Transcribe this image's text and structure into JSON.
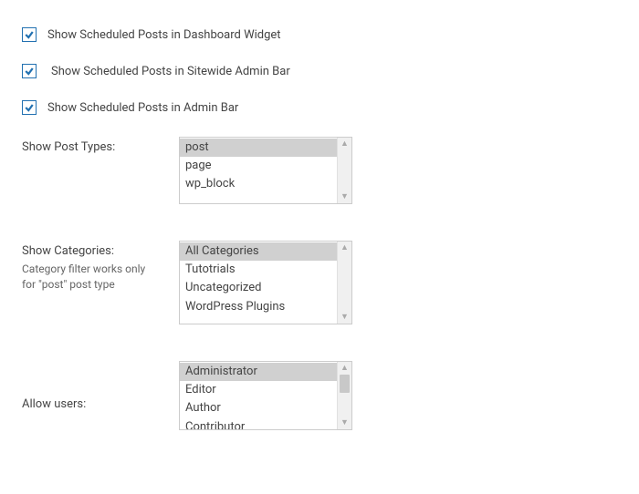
{
  "checkboxes": {
    "dashboard_widget": "Show Scheduled Posts in Dashboard Widget",
    "sitewide_admin_bar": "Show Scheduled Posts in Sitewide Admin Bar",
    "admin_bar": "Show Scheduled Posts in Admin Bar"
  },
  "post_types": {
    "label": "Show Post Types:",
    "options": [
      "post",
      "page",
      "wp_block"
    ],
    "selected": [
      "post"
    ]
  },
  "categories": {
    "label": "Show Categories:",
    "note": "Category filter works only for \"post\" post type",
    "options": [
      "All Categories",
      "Tutotrials",
      "Uncategorized",
      "WordPress Plugins"
    ],
    "selected": [
      "All Categories"
    ]
  },
  "allow_users": {
    "label": "Allow users:",
    "options": [
      "Administrator",
      "Editor",
      "Author",
      "Contributor"
    ],
    "selected": [
      "Administrator"
    ]
  }
}
